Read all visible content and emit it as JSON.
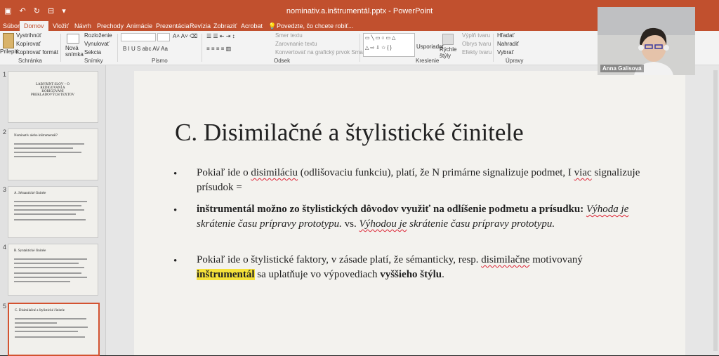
{
  "window": {
    "title": "nominativ.a.inštrumentál.pptx - PowerPoint"
  },
  "tabs": [
    "Súbor",
    "Domov",
    "Vložiť",
    "Návrh",
    "Prechody",
    "Animácie",
    "Prezentácia",
    "Revízia",
    "Zobraziť",
    "Acrobat"
  ],
  "tell_me": "Povedzte, čo chcete robiť...",
  "ribbon": {
    "schranka": {
      "label": "Schránka",
      "paste": "Prilepiť",
      "cut": "Vystrihnúť",
      "copy": "Kopírovať",
      "format": "Kopírovať formát"
    },
    "snimky": {
      "label": "Snímky",
      "new": "Nová snímka",
      "layout": "Rozloženie",
      "reset": "Vynulovať",
      "section": "Sekcia"
    },
    "pismo": {
      "label": "Písmo",
      "styles": "B I U S abc AV Aa"
    },
    "odsek": {
      "label": "Odsek",
      "direction": "Smer textu",
      "align": "Zarovnanie textu",
      "smartart": "Konvertovať na grafický prvok SmartArt"
    },
    "kreslenie": {
      "label": "Kreslenie",
      "arrange": "Usporiadať",
      "quick": "Rýchle štýly",
      "fill": "Výplň tvaru",
      "outline": "Obrys tvaru",
      "effects": "Efekty tvaru"
    },
    "upravy": {
      "label": "Úpravy",
      "find": "Hľadať",
      "replace": "Nahradiť",
      "select": "Vybrať"
    }
  },
  "slides": [
    {
      "num": "1",
      "title": "LABYRINT SLOV – O REDIGOVANÍ A KORIGOVANÍ PREKLADOVÝCH TEXTOV"
    },
    {
      "num": "2",
      "title": "Nominatív alebo inštrumentál?"
    },
    {
      "num": "3",
      "title": "A. Sémantické činitele"
    },
    {
      "num": "4",
      "title": "B. Syntaktické činitele"
    },
    {
      "num": "5",
      "title": "C. Disimilačné a štylistické činitele"
    }
  ],
  "slide": {
    "title": "C. Disimilačné a štylistické činitele",
    "bullet": "•",
    "b1": [
      "Pokiaľ ide o ",
      "disimiláciu",
      " (odlišovaciu funkciu), platí, že N primárne signalizuje podmet, I ",
      "viac",
      " signalizuje prísudok ="
    ],
    "b2": [
      "inštrumentál možno zo štylistických dôvodov využiť na odlíšenie podmetu a prísudku:",
      " ",
      "Výhoda je",
      " skrátenie času prípravy prototypu.",
      " vs. ",
      "Výhodou je",
      " skrátenie času prípravy prototypu."
    ],
    "b3": [
      "Pokiaľ ide o štylistické faktory, v zásade platí, že sémanticky, resp. ",
      "disimilačne",
      " motivovaný ",
      "inštrumentál",
      " sa uplatňuje vo výpovediach ",
      "vyššieho štýlu",
      "."
    ]
  },
  "webcam": {
    "name": "Anna Galisova"
  }
}
